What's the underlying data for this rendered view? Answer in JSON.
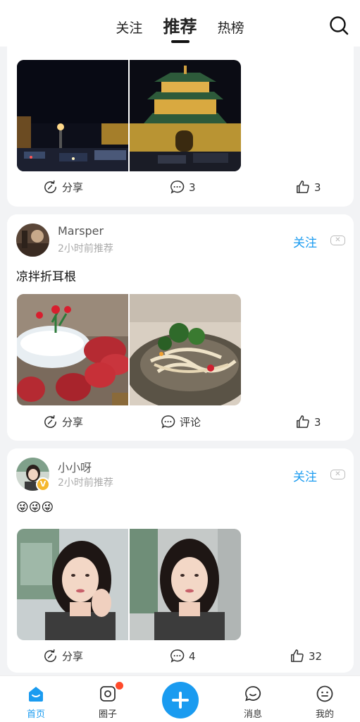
{
  "header": {
    "tabs": [
      {
        "label": "关注"
      },
      {
        "label": "推荐"
      },
      {
        "label": "热榜"
      }
    ],
    "search_icon": "search-icon"
  },
  "posts": [
    {
      "share_label": "分享",
      "comment_label": "3",
      "like_count": "3",
      "images": [
        "night city street",
        "bell tower lit at night"
      ]
    },
    {
      "username": "Marsper",
      "time": "2小时前推荐",
      "follow_label": "关注",
      "text": "凉拌折耳根",
      "share_label": "分享",
      "comment_label": "评论",
      "like_count": "3",
      "images": [
        "raw meat platter with dry ice",
        "cold dressed fish-mint roots"
      ]
    },
    {
      "username": "小小呀",
      "time": "2小时前推荐",
      "follow_label": "关注",
      "text": "😜😜😜",
      "share_label": "分享",
      "comment_label": "4",
      "like_count": "32",
      "images": [
        "woman selfie",
        "woman selfie"
      ]
    }
  ],
  "bottom_nav": [
    {
      "label": "首页",
      "icon": "home-icon",
      "active": true
    },
    {
      "label": "圈子",
      "icon": "circle-icon",
      "badge": true
    },
    {
      "label": "",
      "icon": "plus-icon"
    },
    {
      "label": "消息",
      "icon": "message-icon"
    },
    {
      "label": "我的",
      "icon": "profile-icon"
    }
  ],
  "colors": {
    "accent": "#1a9bf0",
    "badge": "#ff4a2b",
    "background": "#f2f3f5"
  }
}
